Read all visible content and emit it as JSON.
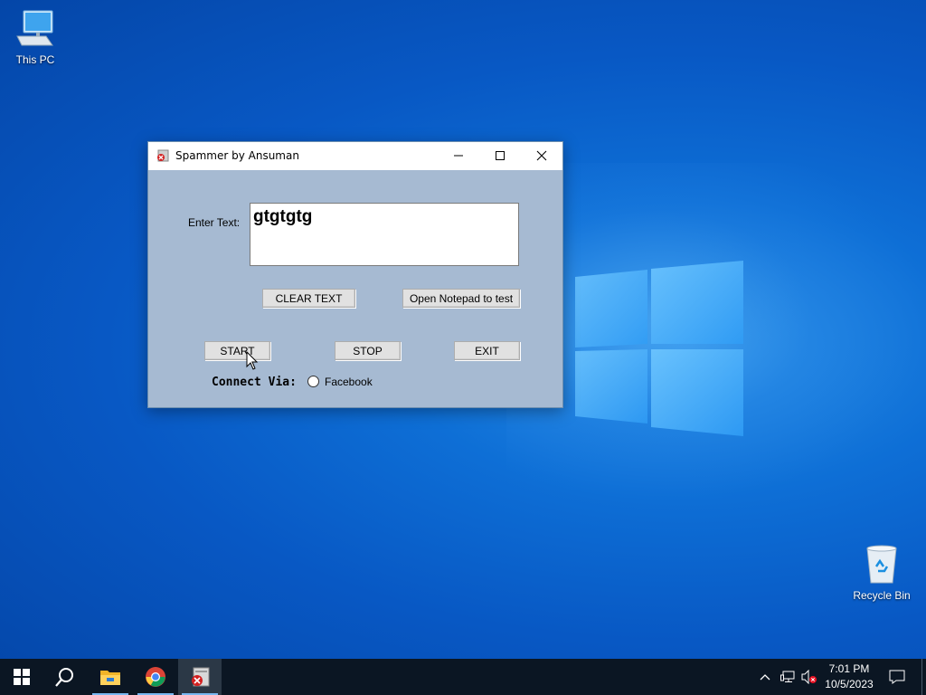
{
  "desktop": {
    "icons": [
      {
        "label": "This PC",
        "icon": "this-pc-icon"
      },
      {
        "label": "Recycle Bin",
        "icon": "recycle-bin-icon"
      }
    ]
  },
  "window": {
    "title": "Spammer by Ansuman",
    "enter_text_label": "Enter Text:",
    "text_value": "gtgtgtg",
    "clear_button": "CLEAR TEXT",
    "notepad_button": "Open Notepad to test",
    "start_button": "START",
    "stop_button": "STOP",
    "exit_button": "EXIT",
    "connect_label": "Connect Via:",
    "radio_option": "Facebook",
    "radio_selected": false
  },
  "taskbar": {
    "items": [
      "start-icon",
      "search-icon",
      "file-explorer-icon",
      "chrome-icon",
      "spammer-app-icon"
    ],
    "active_item": "spammer-app-icon",
    "clock": {
      "time": "7:01 PM",
      "date": "10/5/2023"
    },
    "tray_icons": [
      "chevron-up-icon",
      "network-icon",
      "volume-muted-icon",
      "notification-icon"
    ]
  },
  "colors": {
    "window_client_bg": "#a6bad2",
    "taskbar_bg": "#0b1623",
    "desktop_bg": "#0858c4"
  }
}
